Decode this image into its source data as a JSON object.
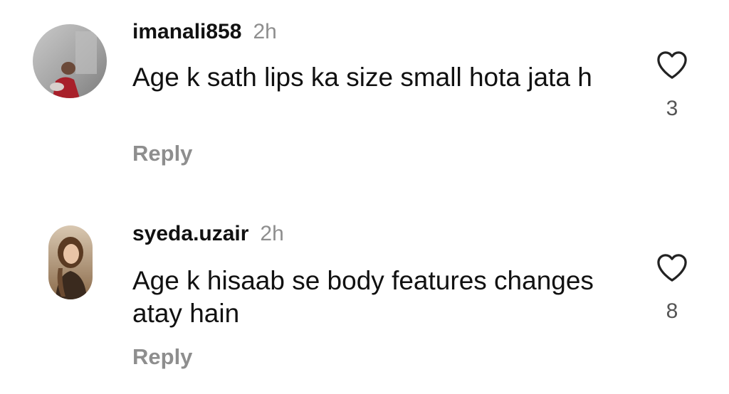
{
  "comments": [
    {
      "username": "imanali858",
      "time": "2h",
      "text": "Age k sath lips ka size small hota jata h",
      "reply_label": "Reply",
      "likes": "3",
      "avatar_icon": "avatar-photo",
      "like_icon": "heart-outline-icon"
    },
    {
      "username": "syeda.uzair",
      "time": "2h",
      "text": "Age k hisaab se body features changes atay hain",
      "reply_label": "Reply",
      "likes": "8",
      "avatar_icon": "avatar-photo",
      "like_icon": "heart-outline-icon"
    }
  ],
  "colors": {
    "background": "#ffffff",
    "text": "#111111",
    "muted": "#8e8e8e"
  }
}
